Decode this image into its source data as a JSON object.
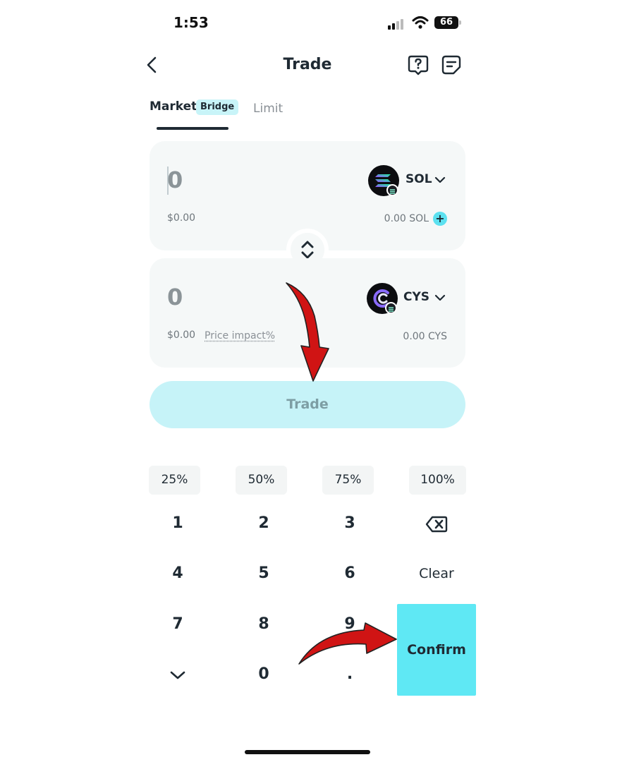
{
  "status_bar": {
    "time": "1:53",
    "battery": "66"
  },
  "header": {
    "title": "Trade"
  },
  "tabs": {
    "market": "Market",
    "bridge_badge": "Bridge",
    "limit": "Limit"
  },
  "from": {
    "amount": "0",
    "usd": "$0.00",
    "token": "SOL",
    "balance": "0.00 SOL"
  },
  "to": {
    "amount": "0",
    "usd": "$0.00",
    "price_impact": "Price impact%",
    "token": "CYS",
    "balance": "0.00 CYS"
  },
  "trade_button": "Trade",
  "percent_options": [
    "25%",
    "50%",
    "75%",
    "100%"
  ],
  "keypad": {
    "k1": "1",
    "k2": "2",
    "k3": "3",
    "k4": "4",
    "k5": "5",
    "k6": "6",
    "clear": "Clear",
    "k7": "7",
    "k8": "8",
    "k9": "9",
    "k0": "0",
    "dot": ".",
    "confirm": "Confirm"
  },
  "colors": {
    "accent": "#5fe8f4",
    "trade_button_bg": "#c6f3f8",
    "card_bg": "#f5f8f8",
    "annotation_arrow": "#d01414"
  },
  "icons": [
    "back-icon",
    "help-icon",
    "orders-icon",
    "swap-icon",
    "backspace-icon",
    "collapse-keyboard-icon",
    "add-funds-icon"
  ]
}
